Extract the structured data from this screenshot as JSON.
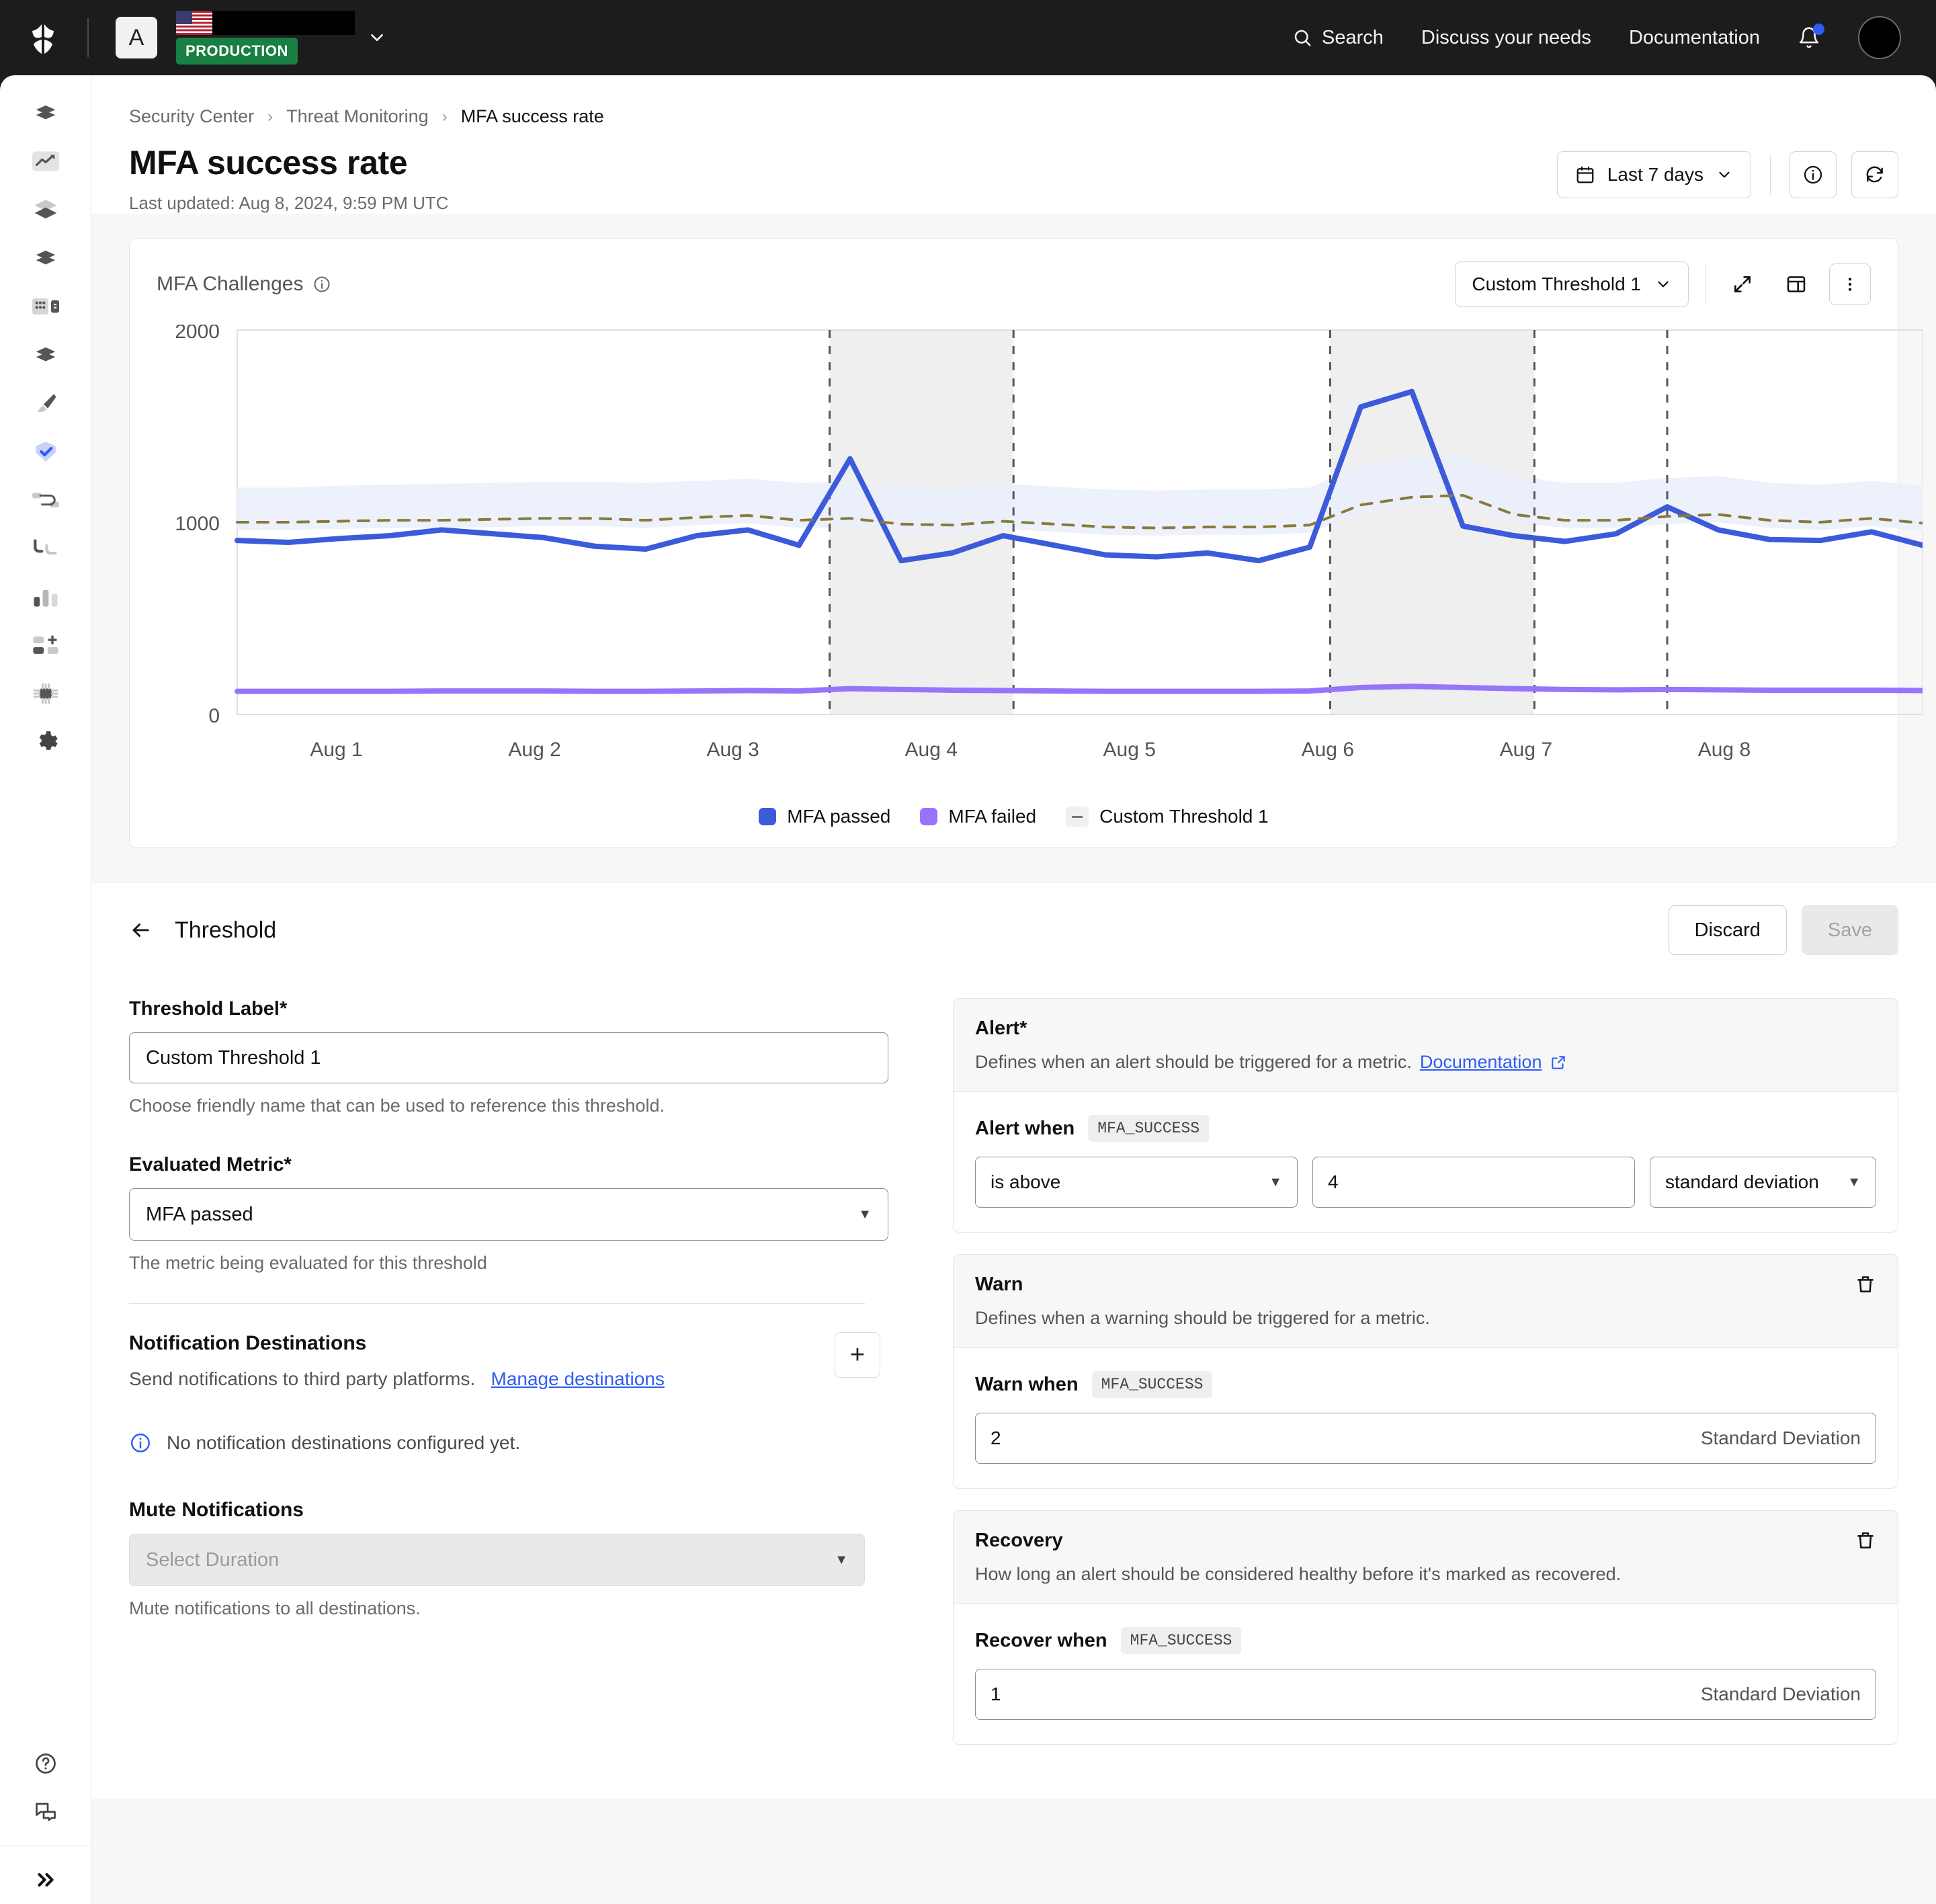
{
  "topbar": {
    "logo_icon": "shield-logo-icon",
    "account_initial": "A",
    "org_flag": "us-flag-icon",
    "org_name_redacted": "",
    "environment_badge": "PRODUCTION",
    "org_caret_icon": "chevron-down-icon",
    "nav": [
      {
        "label": "Search",
        "icon": "search-icon"
      },
      {
        "label": "Discuss your needs",
        "icon": ""
      },
      {
        "label": "Documentation",
        "icon": ""
      }
    ],
    "notifications_icon": "bell-icon",
    "avatar": "user-avatar"
  },
  "rail": {
    "items": [
      {
        "name": "sidebar-item-activity",
        "icon": "lightning-icon",
        "active": false
      },
      {
        "name": "sidebar-item-analytics",
        "icon": "trend-up-icon",
        "active": true
      },
      {
        "name": "sidebar-item-layers",
        "icon": "layers-icon",
        "active": false
      },
      {
        "name": "sidebar-item-actions",
        "icon": "lightning-icon",
        "active": false
      },
      {
        "name": "sidebar-item-modules",
        "icon": "modules-icon",
        "active": false
      },
      {
        "name": "sidebar-item-triggers",
        "icon": "lightning-icon",
        "active": false
      },
      {
        "name": "sidebar-item-branding",
        "icon": "brush-icon",
        "active": false
      },
      {
        "name": "sidebar-item-security",
        "icon": "shield-check-icon",
        "active": true
      },
      {
        "name": "sidebar-item-connections",
        "icon": "link-icon",
        "active": false
      },
      {
        "name": "sidebar-item-flows",
        "icon": "flow-icon",
        "active": false
      },
      {
        "name": "sidebar-item-metrics",
        "icon": "bar-chart-icon",
        "active": false
      },
      {
        "name": "sidebar-item-extensions",
        "icon": "add-block-icon",
        "active": false
      },
      {
        "name": "sidebar-item-infrastructure",
        "icon": "chip-icon",
        "active": false
      },
      {
        "name": "sidebar-item-settings",
        "icon": "gear-icon",
        "active": false
      }
    ],
    "bottom": [
      {
        "name": "sidebar-item-help",
        "icon": "help-circle-icon"
      },
      {
        "name": "sidebar-item-feedback",
        "icon": "chat-icon"
      }
    ],
    "expand": {
      "name": "sidebar-expand-button",
      "icon": "chevrons-right-icon"
    }
  },
  "breadcrumb": {
    "items": [
      "Security Center",
      "Threat Monitoring",
      "MFA success rate"
    ],
    "separator": "›"
  },
  "page": {
    "title": "MFA success rate",
    "last_updated": "Last updated: Aug 8, 2024, 9:59 PM UTC",
    "date_range": "Last 7 days",
    "date_range_icon": "calendar-icon",
    "caret_icon": "chevron-down-icon",
    "info_icon": "info-circle-icon",
    "refresh_icon": "refresh-icon"
  },
  "chart_card": {
    "title": "MFA Challenges",
    "title_info_icon": "info-circle-icon",
    "threshold_select": "Custom Threshold 1",
    "threshold_caret_icon": "chevron-down-icon",
    "expand_icon": "expand-icon",
    "table_icon": "table-icon",
    "more_icon": "kebab-menu-icon"
  },
  "chart_data": {
    "type": "line",
    "title": "MFA Challenges",
    "xlabel": "",
    "ylabel": "",
    "ylim": [
      0,
      2000
    ],
    "yticks": [
      0,
      1000,
      2000
    ],
    "ytick_labels": [
      "0",
      "1000",
      "2000"
    ],
    "x": [
      "Aug 1",
      "Aug 2",
      "Aug 3",
      "Aug 4",
      "Aug 5",
      "Aug 6",
      "Aug 7",
      "Aug 8"
    ],
    "grid": false,
    "legend": [
      {
        "label": "MFA passed",
        "color": "#3b5bdb",
        "marker": "square"
      },
      {
        "label": "MFA failed",
        "color": "#9775fa",
        "marker": "square"
      },
      {
        "label": "Custom Threshold 1",
        "color": "#8a7a3a",
        "marker": "dash"
      }
    ],
    "series": [
      {
        "name": "MFA passed",
        "color": "#3b5bdb",
        "values": [
          905,
          895,
          915,
          930,
          960,
          940,
          920,
          875,
          860,
          930,
          960,
          880,
          1330,
          800,
          840,
          930,
          880,
          830,
          820,
          840,
          800,
          870,
          1600,
          1680,
          980,
          930,
          900,
          940,
          1080,
          960,
          910,
          905,
          950,
          880
        ]
      },
      {
        "name": "MFA failed",
        "color": "#9775fa",
        "values": [
          120,
          120,
          120,
          120,
          122,
          122,
          122,
          120,
          120,
          122,
          124,
          122,
          134,
          130,
          126,
          124,
          122,
          120,
          120,
          120,
          120,
          122,
          140,
          146,
          140,
          134,
          130,
          128,
          130,
          128,
          126,
          126,
          126,
          124
        ]
      },
      {
        "name": "Custom Threshold 1",
        "color": "#8a7a3a",
        "style": "dashed",
        "values": [
          1000,
          1000,
          1005,
          1010,
          1010,
          1015,
          1020,
          1020,
          1010,
          1025,
          1035,
          1010,
          1020,
          990,
          985,
          1005,
          990,
          975,
          970,
          975,
          975,
          985,
          1090,
          1130,
          1140,
          1040,
          1010,
          1010,
          1030,
          1040,
          1010,
          1000,
          1020,
          995
        ]
      }
    ],
    "band": {
      "name": "confidence band",
      "color": "#eaeffc",
      "upper": [
        1180,
        1180,
        1190,
        1195,
        1200,
        1205,
        1210,
        1210,
        1205,
        1215,
        1225,
        1205,
        1210,
        1185,
        1180,
        1200,
        1185,
        1170,
        1165,
        1170,
        1170,
        1180,
        1300,
        1340,
        1350,
        1240,
        1205,
        1205,
        1230,
        1240,
        1205,
        1195,
        1215,
        1190
      ],
      "lower": [
        960,
        960,
        965,
        970,
        970,
        975,
        980,
        980,
        970,
        985,
        995,
        970,
        975,
        950,
        945,
        965,
        950,
        935,
        930,
        935,
        935,
        945,
        1050,
        1090,
        1095,
        1000,
        970,
        970,
        990,
        1000,
        970,
        960,
        980,
        955
      ]
    },
    "highlight_bands": [
      {
        "from": "Aug 3",
        "to": "Aug 3.7",
        "color": "#efefef"
      },
      {
        "from": "Aug 5.6",
        "to": "Aug 6.5",
        "color": "#efefef"
      }
    ],
    "vertical_markers": [
      "Aug 3",
      "Aug 3.7",
      "Aug 5.6",
      "Aug 6.5",
      "Aug 7"
    ]
  },
  "threshold_panel": {
    "back_icon": "arrow-left-icon",
    "title": "Threshold",
    "discard_label": "Discard",
    "save_label": "Save"
  },
  "form_left": {
    "threshold_label": {
      "label": "Threshold Label",
      "required": "*",
      "value": "Custom Threshold 1",
      "hint": "Choose friendly name that can be used to reference this threshold."
    },
    "evaluated_metric": {
      "label": "Evaluated Metric",
      "required": "*",
      "value": "MFA passed",
      "hint": "The metric being evaluated for this threshold"
    },
    "notification_destinations": {
      "title": "Notification Destinations",
      "desc": "Send notifications to third party platforms.",
      "link": "Manage destinations",
      "add_icon": "plus-icon",
      "empty_icon": "info-circle-icon",
      "empty_text": "No notification destinations configured yet."
    },
    "mute_notifications": {
      "title": "Mute Notifications",
      "placeholder": "Select Duration",
      "caret_icon": "chevron-down-icon",
      "hint": "Mute notifications to all destinations."
    }
  },
  "form_right": {
    "alert": {
      "title": "Alert",
      "required": "*",
      "desc": "Defines when an alert should be triggered for a metric.",
      "link": "Documentation",
      "link_icon": "external-link-icon",
      "when_label": "Alert when",
      "metric_code": "MFA_SUCCESS",
      "operator": "is above",
      "value": "4",
      "unit": "standard deviation",
      "caret_icon": "chevron-down-icon"
    },
    "warn": {
      "title": "Warn",
      "desc": "Defines when a warning should be triggered for a metric.",
      "delete_icon": "trash-icon",
      "when_label": "Warn when",
      "metric_code": "MFA_SUCCESS",
      "value": "2",
      "suffix": "Standard Deviation"
    },
    "recovery": {
      "title": "Recovery",
      "desc": "How long an alert should be considered healthy before it's marked as recovered.",
      "delete_icon": "trash-icon",
      "when_label": "Recover when",
      "metric_code": "MFA_SUCCESS",
      "value": "1",
      "suffix": "Standard Deviation"
    }
  }
}
